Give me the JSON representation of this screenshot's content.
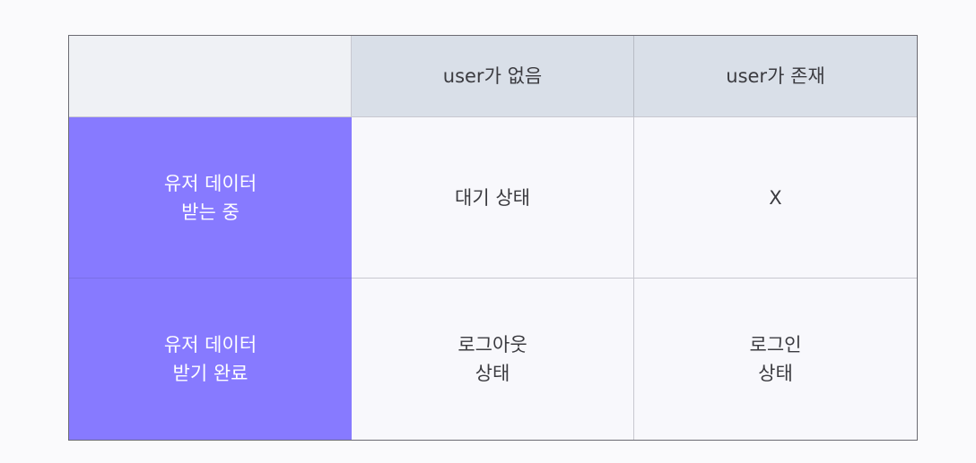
{
  "matrix": {
    "corner": "",
    "columns": [
      "user가 없음",
      "user가 존재"
    ],
    "rows": [
      {
        "header": [
          "유저 데이터",
          "받는 중"
        ],
        "cells": [
          [
            "대기 상태"
          ],
          [
            "X"
          ]
        ]
      },
      {
        "header": [
          "유저 데이터",
          "받기 완료"
        ],
        "cells": [
          [
            "로그아웃",
            "상태"
          ],
          [
            "로그인",
            "상태"
          ]
        ]
      }
    ],
    "colors": {
      "row_header_bg": "#877aff",
      "col_header_bg": "#d9dfe8",
      "corner_bg": "#eff1f5",
      "body_bg": "#f8f8fc",
      "border": "#6b6b72"
    }
  }
}
